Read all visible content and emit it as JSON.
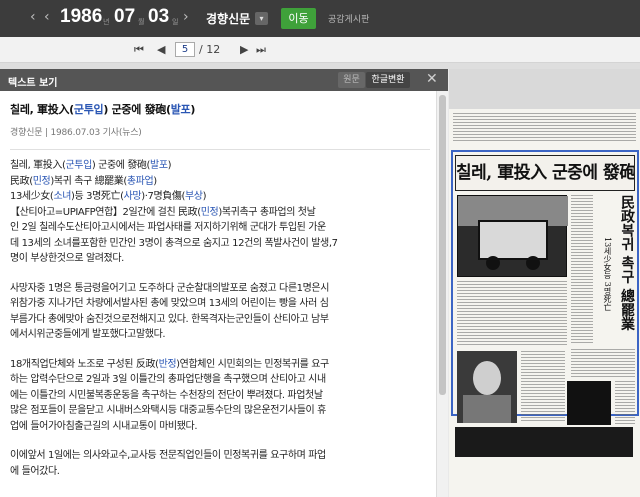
{
  "toolbar": {
    "prev_date": "‹",
    "year": "1986",
    "year_unit": "년",
    "month": "07",
    "month_unit": "월",
    "day": "03",
    "day_unit": "일",
    "paper_name": "경향신문",
    "paper_dropdown": "▾",
    "go_label": "이동",
    "board_label": "공감게시판"
  },
  "pager": {
    "first": "⏮",
    "prev": "◀",
    "current_page": "5",
    "total": "/ 12",
    "next": "▶",
    "last": "⏭"
  },
  "panel": {
    "title": "텍스트 보기",
    "original_label": "원문",
    "hangul_label": "한글변환",
    "close": "✕"
  },
  "article": {
    "title_parts": [
      "칠레, 軍投入(",
      "군투입",
      ") 군중에 發砲(",
      "발포",
      ")"
    ],
    "meta": "경향신문 | 1986.07.03 기사(뉴스)",
    "h1_parts": [
      "칠레, 軍投入(",
      "군투입",
      ") 군중에 發砲(",
      "발포",
      ")"
    ],
    "h2_parts": [
      "民政(",
      "민정",
      ")복귀 촉구 總罷業(",
      "총파업",
      ")"
    ],
    "h3_parts": [
      "13세少女(",
      "소녀",
      ")등 3명死亡(",
      "사망",
      ")·7명負傷(",
      "부상",
      ")"
    ],
    "p1_lines": [
      [
        "【산티아고=UPIAFP연합】2일간에 걸친 民政(",
        "민정",
        ")복귀촉구 총파업의 첫날"
      ],
      [
        "인 2일 칠레수도산티아고시에서는 파업사태를 저지하기위해 군대가 투입된 가운"
      ],
      [
        "데 13세의 소녀를포함한 민간인 3명이 총격으로 숨지고 12건의 폭발사건이 발생,7"
      ],
      [
        "명이 부상한것으로 알려졌다."
      ]
    ],
    "p2_lines": [
      " 사망자중 1명은 통금령을어기고 도주하다 군순찰대의발포로 숨졌고 다른1명은시",
      "위참가중 지나가던 차량에서발사된 총에 맞았으며 13세의 어린이는 빵을 사러 심",
      "부름가다 총에맞아 숨진것으로전해지고 있다. 한목격자는군인들이 산티아고 남부",
      "에서시위군중들에게 발포했다고말했다."
    ],
    "p3_lines": [
      [
        " 18개직업단체와 노조로 구성된 反政(",
        "반정",
        ")연합체인 시민회의는 민정복귀를 요구"
      ],
      [
        "하는 압력수단으로 2일과 3일 이틀간의 총파업단행을 촉구했으며 산티아고 시내"
      ],
      [
        "에는 이틀간의 시민불복종운동을 촉구하는 수천장의 전단이 뿌려졌다. 파업첫날"
      ],
      [
        "많은 점포들이 문을닫고 시내버스와택시등 대중교통수단의 많은운전기사들이 휴"
      ],
      [
        "업에 들어가아침출근길의 시내교통이 마비됐다."
      ]
    ],
    "p4_lines": [
      " 이에앞서 1일에는 의사와교수,교사등 전문직업인들이 민정복귀를 요구하며 파업",
      "에 들어갔다."
    ]
  },
  "scan": {
    "headline": "칠레, 軍投入 군중에 發砲",
    "vertical_headline": "民政복귀 촉구 總罷業",
    "vertical_sub": "13세少女등 3명死亡"
  }
}
